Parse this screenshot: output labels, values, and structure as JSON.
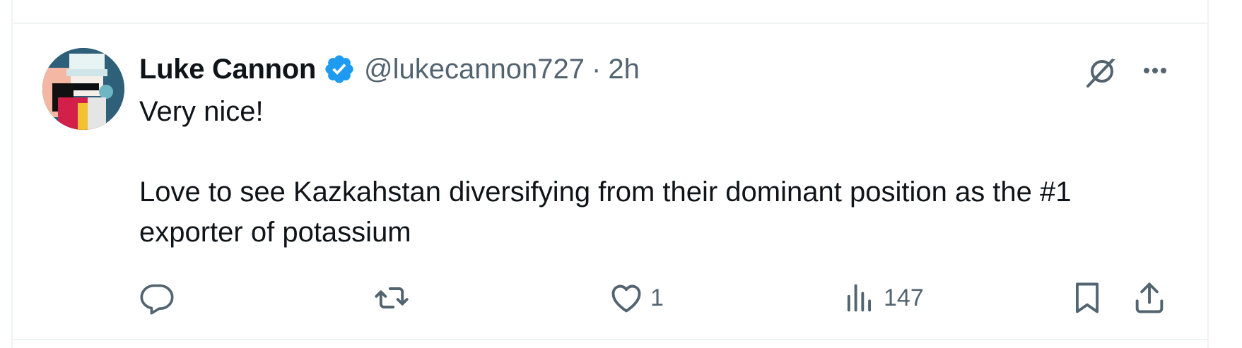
{
  "tweet": {
    "display_name": "Luke Cannon",
    "handle": "@lukecannon727",
    "separator": "·",
    "time": "2h",
    "text": "Very nice!\n\nLove to see Kazkahstan diversifying from their dominant position as the #1 exporter of potassium",
    "verified": true
  },
  "actions": {
    "reply_count": "",
    "retweet_count": "",
    "like_count": "1",
    "views_count": "147"
  },
  "icons": {
    "verified": "verified-badge-icon",
    "grok": "grok-icon",
    "more": "more-icon",
    "reply": "reply-icon",
    "retweet": "retweet-icon",
    "like": "heart-icon",
    "views": "views-icon",
    "bookmark": "bookmark-icon",
    "share": "share-icon"
  },
  "colors": {
    "text": "#0f1419",
    "secondary": "#536471",
    "verified": "#1d9bf0",
    "border": "#eff3f4"
  }
}
